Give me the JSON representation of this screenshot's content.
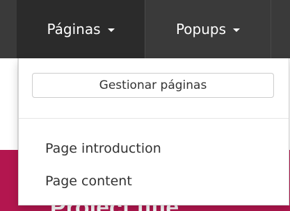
{
  "navbar": {
    "items": [
      {
        "label": "Páginas",
        "has_caret": true,
        "active": true
      },
      {
        "label": "Popups",
        "has_caret": true,
        "active": false
      }
    ]
  },
  "dropdown": {
    "manage_button_label": "Gestionar páginas",
    "items": [
      {
        "label": "Page introduction"
      },
      {
        "label": "Page content"
      }
    ]
  },
  "hero": {
    "title": "Project title"
  },
  "colors": {
    "navbar_bg": "#3a3a3a",
    "navbar_active_bg": "#2b2b2b",
    "hero_bg": "#b3164f",
    "text": "#333333"
  }
}
